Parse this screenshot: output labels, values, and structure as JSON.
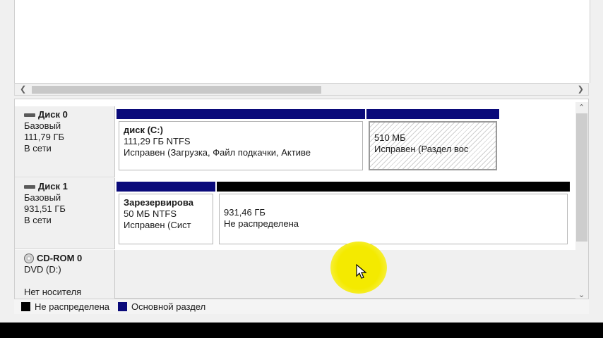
{
  "colors": {
    "primary_partition": "#0a0a7a",
    "unallocated": "#000000",
    "cursor_highlight": "#f4ea00"
  },
  "disks": [
    {
      "name": "Диск 0",
      "type": "Базовый",
      "size": "111,79 ГБ",
      "status": "В сети",
      "partitions": [
        {
          "name": "диск  (C:)",
          "size_fs": "111,29 ГБ NTFS",
          "status": "Исправен (Загрузка, Файл подкачки, Активе",
          "bar": "primary"
        },
        {
          "size_fs": "510 МБ",
          "status": "Исправен (Раздел вос",
          "bar": "primary",
          "hatched": true
        }
      ]
    },
    {
      "name": "Диск 1",
      "type": "Базовый",
      "size": "931,51 ГБ",
      "status": "В сети",
      "partitions": [
        {
          "name": "Зарезервирова",
          "size_fs": "50 МБ NTFS",
          "status": "Исправен (Сист",
          "bar": "primary"
        },
        {
          "size_fs": "931,46 ГБ",
          "status": "Не распределена",
          "bar": "unallocated"
        }
      ]
    },
    {
      "name": "CD-ROM 0",
      "type": "DVD (D:)",
      "status": "Нет носителя"
    }
  ],
  "legend": [
    {
      "label": "Не распределена",
      "color": "#000000"
    },
    {
      "label": "Основной раздел",
      "color": "#0a0a7a"
    }
  ],
  "icons": {
    "hdd": "disk-drive-icon",
    "cdrom": "cd-drive-icon",
    "left": "scroll-left-arrow-icon",
    "right": "scroll-right-arrow-icon",
    "up": "scroll-up-arrow-icon",
    "down": "scroll-down-arrow-icon"
  }
}
